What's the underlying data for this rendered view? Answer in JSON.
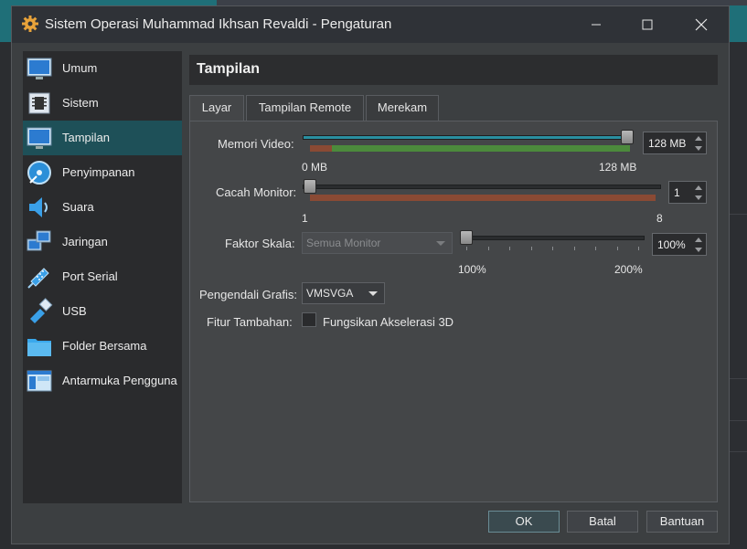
{
  "window": {
    "title": "Sistem Operasi Muhammad Ikhsan Revaldi - Pengaturan",
    "app_icon": "gear-icon",
    "controls": [
      "minimize-icon",
      "maximize-icon",
      "close-icon"
    ]
  },
  "sidebar": {
    "items": [
      {
        "label": "Umum",
        "icon": "monitor-general-icon"
      },
      {
        "label": "Sistem",
        "icon": "chip-icon"
      },
      {
        "label": "Tampilan",
        "icon": "display-icon",
        "active": true
      },
      {
        "label": "Penyimpanan",
        "icon": "disk-icon"
      },
      {
        "label": "Suara",
        "icon": "speaker-icon"
      },
      {
        "label": "Jaringan",
        "icon": "network-icon"
      },
      {
        "label": "Port Serial",
        "icon": "serial-port-icon"
      },
      {
        "label": "USB",
        "icon": "usb-icon"
      },
      {
        "label": "Folder Bersama",
        "icon": "folder-icon"
      },
      {
        "label": "Antarmuka Pengguna",
        "icon": "user-interface-icon"
      }
    ]
  },
  "page": {
    "title": "Tampilan",
    "tabs": [
      {
        "label": "Layar",
        "active": true
      },
      {
        "label": "Tampilan Remote"
      },
      {
        "label": "Merekam"
      }
    ]
  },
  "screen": {
    "video_memory": {
      "label": "Memori Video:",
      "value": "128 MB",
      "min_label": "0 MB",
      "max_label": "128 MB",
      "level": 1.0
    },
    "monitor_count": {
      "label": "Cacah Monitor:",
      "value": "1",
      "min_label": "1",
      "max_label": "8",
      "level": 0.0
    },
    "scale_factor": {
      "label": "Faktor Skala:",
      "combo_value": "Semua Monitor",
      "value": "100%",
      "min_label": "100%",
      "max_label": "200%",
      "level": 0.0
    },
    "graphics_controller": {
      "label": "Pengendali Grafis:",
      "value": "VMSVGA"
    },
    "extended_features": {
      "label": "Fitur Tambahan:",
      "checkbox_label": "Fungsikan Akselerasi 3D",
      "checked": false
    }
  },
  "buttons": {
    "ok": "OK",
    "cancel": "Batal",
    "help": "Bantuan"
  },
  "colors": {
    "accent_selected": "#1e5058",
    "slider_fill": "#2a8fa0",
    "zone_green": "#4c8a3c",
    "zone_red": "#8a4a34"
  }
}
